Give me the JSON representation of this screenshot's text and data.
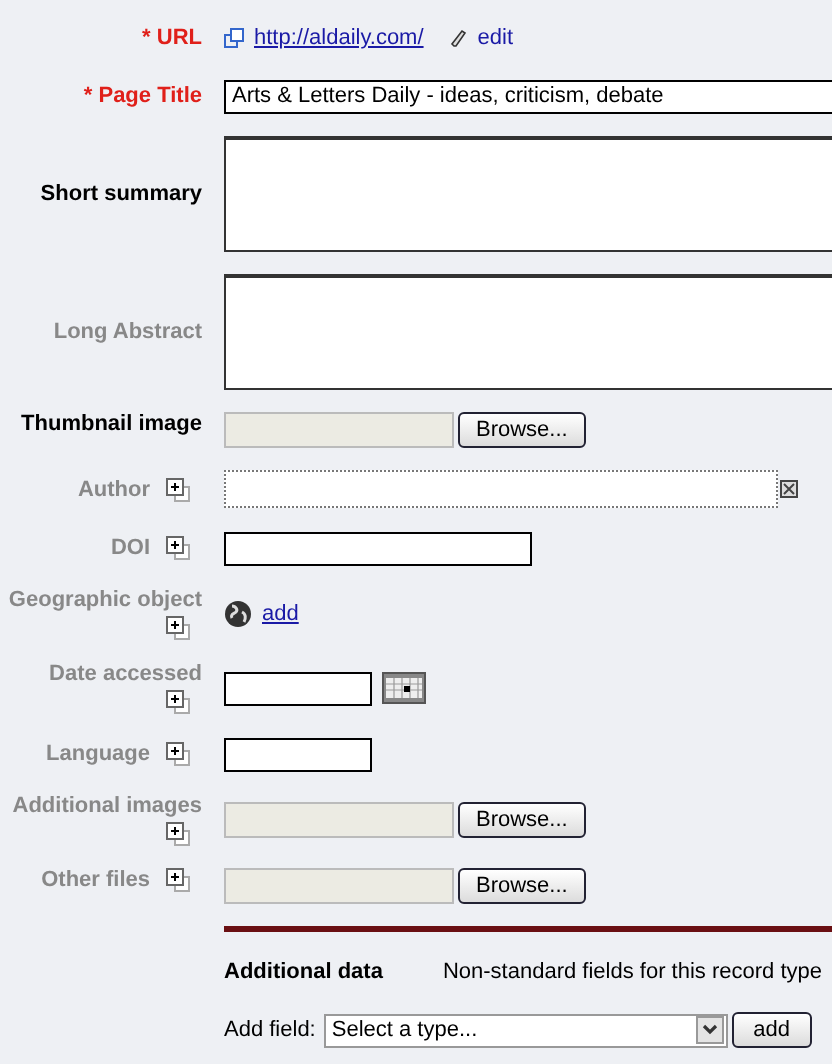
{
  "fields": [
    {
      "kind": "link",
      "label": "* URL",
      "required": true,
      "repeatable": false,
      "link": "http://aldaily.com/",
      "edit": "edit"
    },
    {
      "kind": "text",
      "label": "* Page Title",
      "required": true,
      "repeatable": false,
      "value": "Arts & Letters Daily - ideas, criticism, debate"
    },
    {
      "kind": "textarea",
      "label": "Short summary",
      "required": false,
      "muted": false,
      "repeatable": false
    },
    {
      "kind": "textarea",
      "label": "Long Abstract",
      "required": false,
      "muted": true,
      "repeatable": false
    },
    {
      "kind": "file",
      "label": "Thumbnail image",
      "required": false,
      "muted": false,
      "repeatable": false,
      "button": "Browse..."
    },
    {
      "kind": "author",
      "label": "Author",
      "required": false,
      "muted": true,
      "repeatable": true
    },
    {
      "kind": "short",
      "label": "DOI",
      "required": false,
      "muted": true,
      "repeatable": true
    },
    {
      "kind": "geo",
      "label": "Geographic object",
      "required": false,
      "muted": true,
      "repeatable": true,
      "link": "add"
    },
    {
      "kind": "date",
      "label": "Date accessed",
      "required": false,
      "muted": true,
      "repeatable": true
    },
    {
      "kind": "tiny",
      "label": "Language",
      "required": false,
      "muted": true,
      "repeatable": true
    },
    {
      "kind": "file",
      "label": "Additional images",
      "required": false,
      "muted": true,
      "repeatable": true,
      "button": "Browse..."
    },
    {
      "kind": "file",
      "label": "Other files",
      "required": false,
      "muted": true,
      "repeatable": true,
      "button": "Browse..."
    }
  ],
  "additional": {
    "title": "Additional data",
    "note": "Non-standard fields for this record type",
    "add_label": "Add field:",
    "select_placeholder": "Select a type...",
    "button": "add"
  }
}
